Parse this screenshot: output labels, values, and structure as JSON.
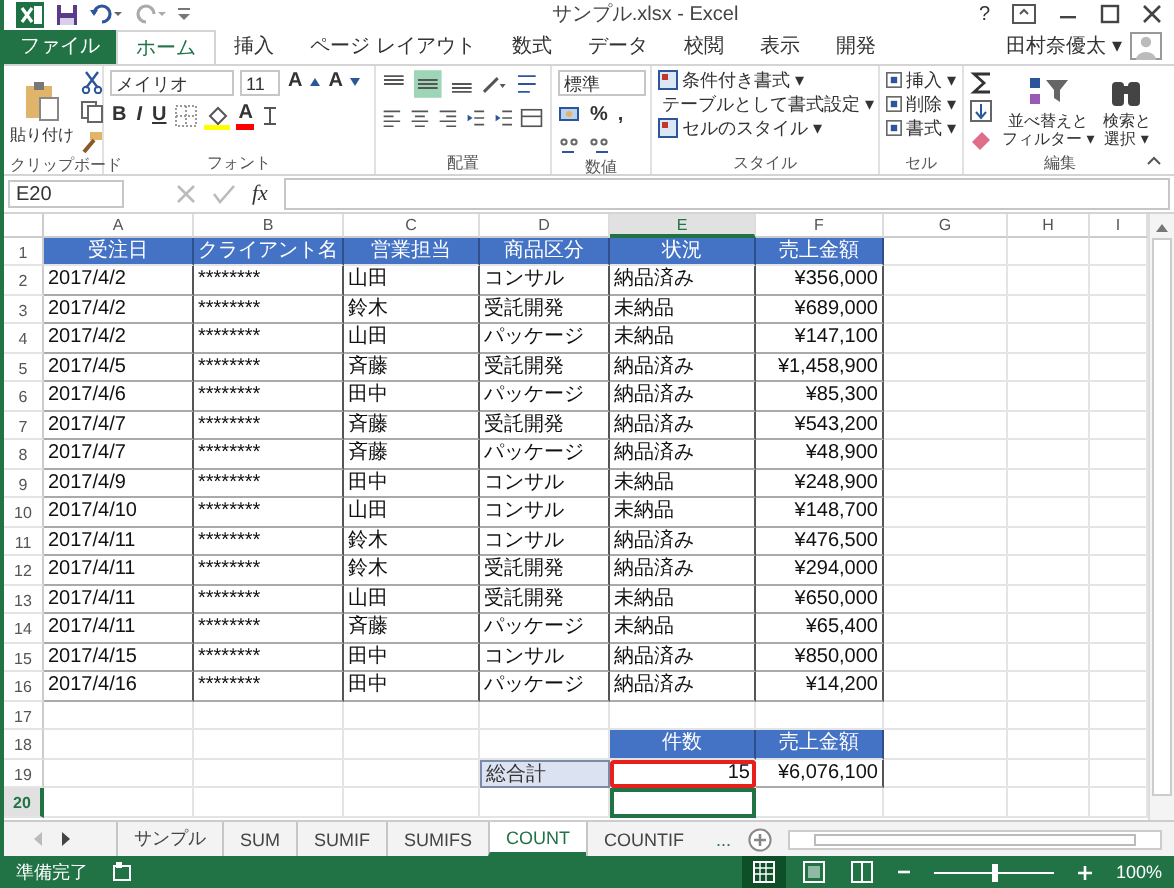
{
  "window": {
    "title": "サンプル.xlsx - Excel",
    "help": "?"
  },
  "ribbon_tabs": [
    {
      "label": "ファイル",
      "kind": "file",
      "selected": false
    },
    {
      "label": "ホーム",
      "kind": "tab",
      "selected": true
    },
    {
      "label": "挿入",
      "kind": "tab",
      "selected": false
    },
    {
      "label": "ページ レイアウト",
      "kind": "tab",
      "selected": false
    },
    {
      "label": "数式",
      "kind": "tab",
      "selected": false
    },
    {
      "label": "データ",
      "kind": "tab",
      "selected": false
    },
    {
      "label": "校閲",
      "kind": "tab",
      "selected": false
    },
    {
      "label": "表示",
      "kind": "tab",
      "selected": false
    },
    {
      "label": "開発",
      "kind": "tab",
      "selected": false
    }
  ],
  "user": {
    "name": "田村奈優太 ▾"
  },
  "ribbon": {
    "clipboard": {
      "paste": "貼り付け",
      "label": "クリップボード"
    },
    "font": {
      "name": "メイリオ",
      "size": "11",
      "grow": "A",
      "shrink": "A",
      "styles": [
        "B",
        "I",
        "U"
      ],
      "color_letter": "A",
      "label": "フォント"
    },
    "alignment": {
      "label": "配置"
    },
    "number": {
      "format": "標準",
      "percent": "%",
      "comma": ",",
      "label": "数値"
    },
    "styles": {
      "items": [
        "条件付き書式 ▾",
        "テーブルとして書式設定 ▾",
        "セルのスタイル ▾"
      ],
      "label": "スタイル"
    },
    "cells": {
      "items": [
        "挿入 ▾",
        "削除 ▾",
        "書式 ▾"
      ],
      "label": "セル"
    },
    "editing": {
      "sort": [
        "並べ替えと",
        "フィルター ▾"
      ],
      "find": [
        "検索と",
        "選択 ▾"
      ],
      "label": "編集"
    }
  },
  "formula_bar": {
    "name_box": "E20",
    "fx": "fx"
  },
  "sheet": {
    "columns": [
      {
        "label": "A",
        "selected": false
      },
      {
        "label": "B",
        "selected": false
      },
      {
        "label": "C",
        "selected": false
      },
      {
        "label": "D",
        "selected": false
      },
      {
        "label": "E",
        "selected": true
      },
      {
        "label": "F",
        "selected": false
      },
      {
        "label": "G",
        "selected": false
      },
      {
        "label": "H",
        "selected": false
      },
      {
        "label": "I",
        "selected": false
      }
    ],
    "row_numbers": [
      {
        "label": "1",
        "selected": false
      },
      {
        "label": "2",
        "selected": false
      },
      {
        "label": "3",
        "selected": false
      },
      {
        "label": "4",
        "selected": false
      },
      {
        "label": "5",
        "selected": false
      },
      {
        "label": "6",
        "selected": false
      },
      {
        "label": "7",
        "selected": false
      },
      {
        "label": "8",
        "selected": false
      },
      {
        "label": "9",
        "selected": false
      },
      {
        "label": "10",
        "selected": false
      },
      {
        "label": "11",
        "selected": false
      },
      {
        "label": "12",
        "selected": false
      },
      {
        "label": "13",
        "selected": false
      },
      {
        "label": "14",
        "selected": false
      },
      {
        "label": "15",
        "selected": false
      },
      {
        "label": "16",
        "selected": false
      },
      {
        "label": "17",
        "selected": false
      },
      {
        "label": "18",
        "selected": false
      },
      {
        "label": "19",
        "selected": false
      },
      {
        "label": "20",
        "selected": true
      }
    ],
    "header_row": [
      "受注日",
      "クライアント名",
      "営業担当",
      "商品区分",
      "状況",
      "売上金額"
    ],
    "data_rows": [
      [
        "2017/4/2",
        "********",
        "山田",
        "コンサル",
        "納品済み",
        "¥356,000"
      ],
      [
        "2017/4/2",
        "********",
        "鈴木",
        "受託開発",
        "未納品",
        "¥689,000"
      ],
      [
        "2017/4/2",
        "********",
        "山田",
        "パッケージ",
        "未納品",
        "¥147,100"
      ],
      [
        "2017/4/5",
        "********",
        "斉藤",
        "受託開発",
        "納品済み",
        "¥1,458,900"
      ],
      [
        "2017/4/6",
        "********",
        "田中",
        "パッケージ",
        "納品済み",
        "¥85,300"
      ],
      [
        "2017/4/7",
        "********",
        "斉藤",
        "受託開発",
        "納品済み",
        "¥543,200"
      ],
      [
        "2017/4/7",
        "********",
        "斉藤",
        "パッケージ",
        "納品済み",
        "¥48,900"
      ],
      [
        "2017/4/9",
        "********",
        "田中",
        "コンサル",
        "未納品",
        "¥248,900"
      ],
      [
        "2017/4/10",
        "********",
        "山田",
        "コンサル",
        "未納品",
        "¥148,700"
      ],
      [
        "2017/4/11",
        "********",
        "鈴木",
        "コンサル",
        "納品済み",
        "¥476,500"
      ],
      [
        "2017/4/11",
        "********",
        "鈴木",
        "受託開発",
        "納品済み",
        "¥294,000"
      ],
      [
        "2017/4/11",
        "********",
        "山田",
        "受託開発",
        "未納品",
        "¥650,000"
      ],
      [
        "2017/4/11",
        "********",
        "斉藤",
        "パッケージ",
        "未納品",
        "¥65,400"
      ],
      [
        "2017/4/15",
        "********",
        "田中",
        "コンサル",
        "納品済み",
        "¥850,000"
      ],
      [
        "2017/4/16",
        "********",
        "田中",
        "パッケージ",
        "納品済み",
        "¥14,200"
      ]
    ],
    "summary": {
      "headers": [
        "件数",
        "売上金額"
      ],
      "label": "総合計",
      "count": "15",
      "total": "¥6,076,100",
      "count_highlighted": true
    }
  },
  "sheet_tabs": [
    {
      "label": "サンプル",
      "selected": false
    },
    {
      "label": "SUM",
      "selected": false
    },
    {
      "label": "SUMIF",
      "selected": false
    },
    {
      "label": "SUMIFS",
      "selected": false
    },
    {
      "label": "COUNT",
      "selected": true
    },
    {
      "label": "COUNTIF",
      "selected": false
    }
  ],
  "more_sheets": "...",
  "status_bar": {
    "status": "準備完了",
    "zoom": "100%",
    "zoom_slider": {
      "level": 0.5
    }
  }
}
